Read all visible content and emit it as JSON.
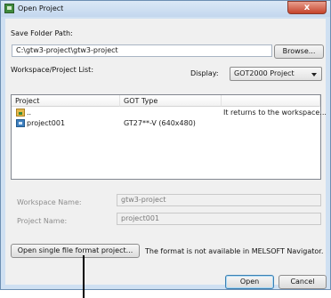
{
  "window": {
    "title": "Open Project",
    "close_glyph": "x"
  },
  "save_folder": {
    "label": "Save Folder Path:",
    "value": "C:\\gtw3-project\\gtw3-project",
    "browse_label": "Browse..."
  },
  "list_label": "Workspace/Project List:",
  "display": {
    "label": "Display:",
    "value": "GOT2000 Project"
  },
  "table": {
    "columns": [
      "Project",
      "GOT Type",
      ""
    ],
    "rows": [
      {
        "project": "..",
        "got_type": "",
        "note": "It returns to the workspace...",
        "icon": "parent-folder-icon"
      },
      {
        "project": "project001",
        "got_type": "GT27**-V (640x480)",
        "note": "",
        "icon": "project-icon"
      }
    ]
  },
  "workspace_name": {
    "label": "Workspace Name:",
    "value": "gtw3-project"
  },
  "project_name": {
    "label": "Project Name:",
    "value": "project001"
  },
  "single_file": {
    "button_label": "Open single file format project...",
    "note": "The format is not available in MELSOFT Navigator."
  },
  "footer": {
    "open_label": "Open",
    "cancel_label": "Cancel"
  }
}
